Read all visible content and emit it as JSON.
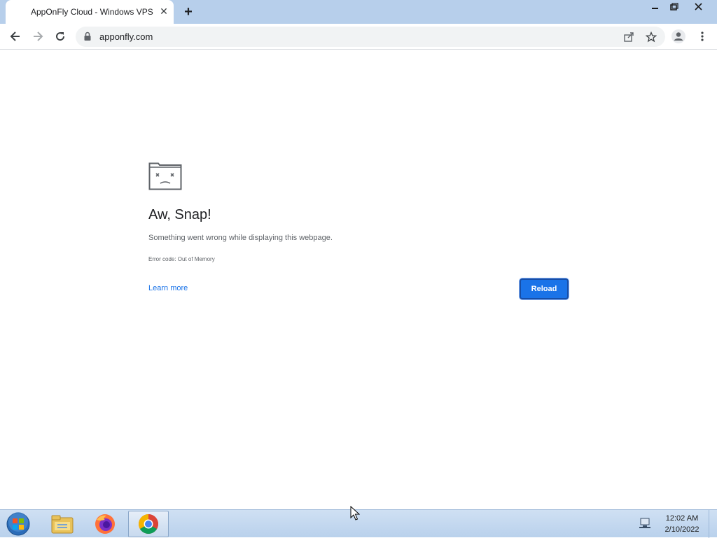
{
  "browser": {
    "tab_title": "AppOnFly Cloud - Windows VPS",
    "tab_close_icon": "close-icon",
    "new_tab_icon": "plus-icon",
    "window_controls": [
      "minimize-icon",
      "restore-icon",
      "close-icon"
    ],
    "url": "apponfly.com",
    "toolbar_icons": [
      "back-icon",
      "forward-icon",
      "reload-icon",
      "lock-icon",
      "share-icon",
      "star-icon",
      "profile-icon",
      "menu-icon"
    ]
  },
  "error_page": {
    "heading": "Aw, Snap!",
    "message": "Something went wrong while displaying this webpage.",
    "error_code": "Error code: Out of Memory",
    "learn_more": "Learn more",
    "reload_label": "Reload",
    "accent_color": "#1a73e8"
  },
  "taskbar": {
    "apps": [
      "start-orb-icon",
      "file-explorer-icon",
      "firefox-icon",
      "chrome-icon"
    ],
    "active_app": "chrome-icon",
    "time": "12:02 AM",
    "date": "2/10/2022"
  }
}
